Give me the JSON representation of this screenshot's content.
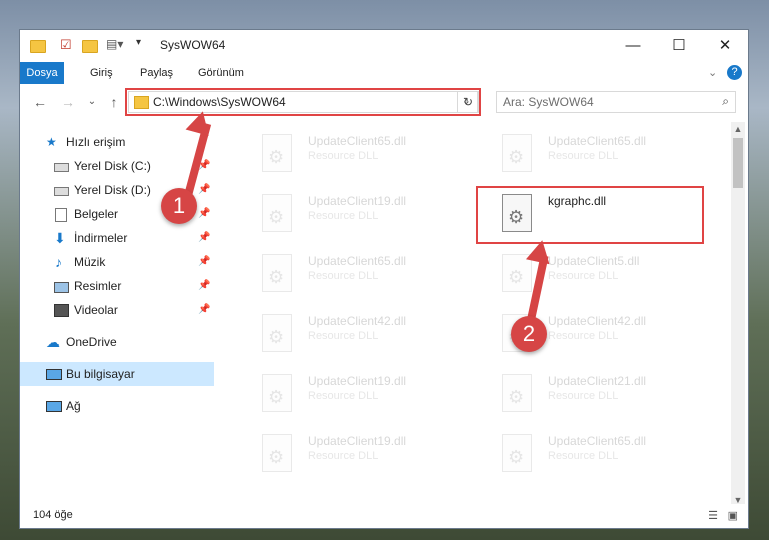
{
  "window": {
    "title": "SysWOW64",
    "controls": {
      "minimize": "—",
      "maximize": "☐",
      "close": "✕"
    }
  },
  "ribbon": {
    "tabs": [
      "Dosya",
      "Giriş",
      "Paylaş",
      "Görünüm"
    ]
  },
  "address": {
    "path": "C:\\Windows\\SysWOW64",
    "search_placeholder": "Ara: SysWOW64"
  },
  "nav": {
    "items": [
      {
        "label": "Hızlı erişim",
        "icon": "star-icon"
      },
      {
        "label": "Yerel Disk (C:)",
        "icon": "drive-icon",
        "pinned": true
      },
      {
        "label": "Yerel Disk (D:)",
        "icon": "drive-icon",
        "pinned": true
      },
      {
        "label": "Belgeler",
        "icon": "documents-icon",
        "pinned": true
      },
      {
        "label": "İndirmeler",
        "icon": "downloads-icon",
        "pinned": true
      },
      {
        "label": "Müzik",
        "icon": "music-icon",
        "pinned": true
      },
      {
        "label": "Resimler",
        "icon": "pictures-icon",
        "pinned": true
      },
      {
        "label": "Videolar",
        "icon": "videos-icon",
        "pinned": true
      },
      {
        "label": "OneDrive",
        "icon": "cloud-icon"
      },
      {
        "label": "Bu bilgisayar",
        "icon": "computer-icon",
        "selected": true
      },
      {
        "label": "Ağ",
        "icon": "network-icon"
      }
    ]
  },
  "files": [
    {
      "name": "UpdateClient65.dll",
      "type": "Resource DLL"
    },
    {
      "name": "UpdateClient65.dll",
      "type": "Resource DLL"
    },
    {
      "name": "UpdateClient19.dll",
      "type": "Resource DLL"
    },
    {
      "name": "kgraphc.dll",
      "type": ""
    },
    {
      "name": "UpdateClient65.dll",
      "type": "Resource DLL"
    },
    {
      "name": "UpdateClient5.dll",
      "type": "Resource DLL"
    },
    {
      "name": "UpdateClient42.dll",
      "type": "Resource DLL"
    },
    {
      "name": "UpdateClient42.dll",
      "type": "Resource DLL"
    },
    {
      "name": "UpdateClient19.dll",
      "type": "Resource DLL"
    },
    {
      "name": "UpdateClient21.dll",
      "type": "Resource DLL"
    },
    {
      "name": "UpdateClient19.dll",
      "type": "Resource DLL"
    },
    {
      "name": "UpdateClient65.dll",
      "type": "Resource DLL"
    }
  ],
  "status": {
    "count": "104 öğe"
  },
  "annotations": {
    "badge1": "1",
    "badge2": "2"
  },
  "colors": {
    "accent": "#1979ca",
    "highlight": "#e04444",
    "badge": "#d64545"
  }
}
